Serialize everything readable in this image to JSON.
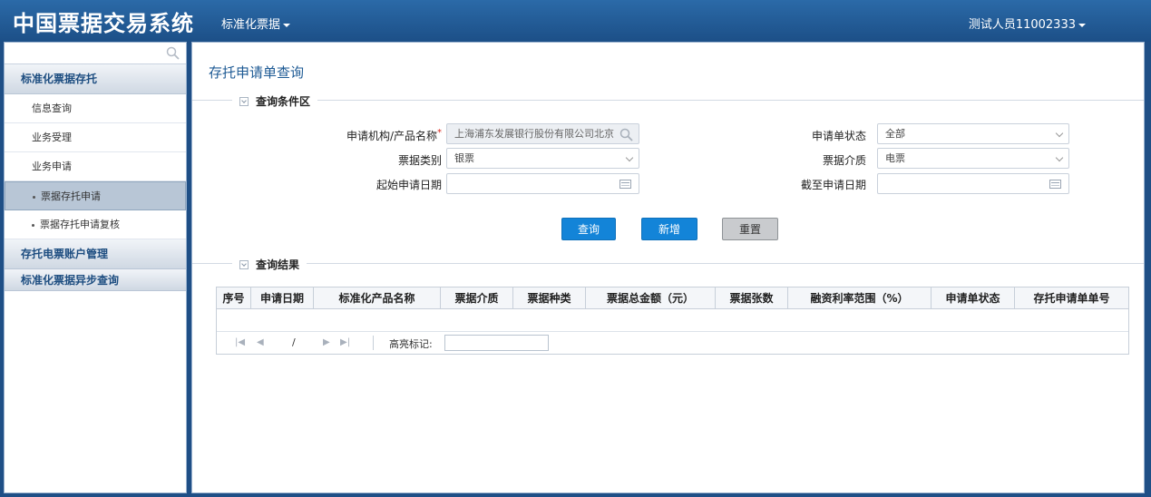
{
  "header": {
    "title": "中国票据交易系统",
    "menu_label": "标准化票据",
    "user_label": "测试人员11002333"
  },
  "sidebar": {
    "search_placeholder": "",
    "group1": "标准化票据存托",
    "items": [
      "信息查询",
      "业务受理",
      "业务申请"
    ],
    "subitems": [
      "票据存托申请",
      "票据存托申请复核"
    ],
    "group2": "存托电票账户管理",
    "group3": "标准化票据异步查询"
  },
  "main": {
    "page_title": "存托申请单查询",
    "criteria_label": "查询条件区",
    "results_label": "查询结果",
    "form": {
      "org_label": "申请机构/产品名称",
      "org_value": "上海浦东发展银行股份有限公司北京",
      "status_label": "申请单状态",
      "status_value": "全部",
      "bill_type_label": "票据类别",
      "bill_type_value": "银票",
      "medium_label": "票据介质",
      "medium_value": "电票",
      "start_date_label": "起始申请日期",
      "end_date_label": "截至申请日期"
    },
    "buttons": {
      "query": "查询",
      "add": "新增",
      "reset": "重置"
    },
    "table": {
      "columns": [
        "序号",
        "申请日期",
        "标准化产品名称",
        "票据介质",
        "票据种类",
        "票据总金额（元）",
        "票据张数",
        "融资利率范围（%）",
        "申请单状态",
        "存托申请单单号"
      ],
      "pager_slash": "/",
      "highlight_label": "高亮标记:"
    }
  },
  "colors": {
    "header_bg": "#1f5a96",
    "primary_button": "#1384d8",
    "title_text": "#1d5a94"
  }
}
